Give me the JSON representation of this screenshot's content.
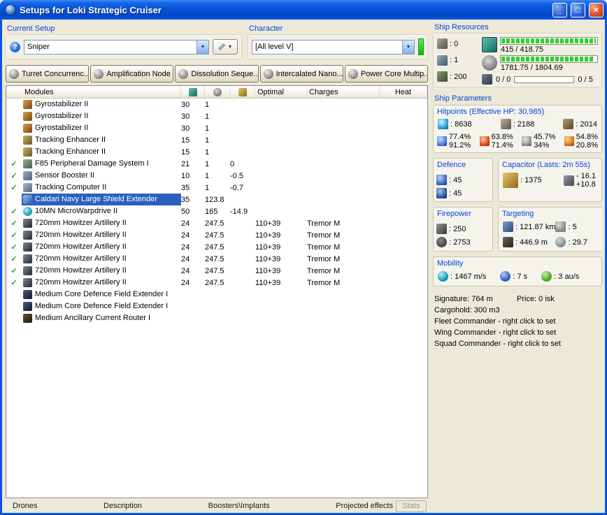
{
  "window": {
    "title": "Setups for Loki Strategic Cruiser"
  },
  "icons": {
    "help": "?",
    "dropdown_arrow": "▼",
    "check": "✓",
    "minimize": "_",
    "maximize": "□",
    "close": "×"
  },
  "current_setup": {
    "label": "Current Setup",
    "value": "Sniper"
  },
  "character": {
    "label": "Character",
    "value": "[All level V]"
  },
  "ship_resources": {
    "label": "Ship Resources",
    "turrets": ": 0",
    "launchers": ": 1",
    "calibration": ": 200",
    "cpu": "415 / 418.75",
    "powergrid": "1781.75 / 1804.69",
    "slots_left": "0 / 0",
    "slots_right": "0 / 5"
  },
  "subsystems": [
    {
      "label": "Turret Concurrenc..."
    },
    {
      "label": "Amplification Node"
    },
    {
      "label": "Dissolution Seque..."
    },
    {
      "label": "Intercalated Nano..."
    },
    {
      "label": "Power Core Multip..."
    }
  ],
  "modules": {
    "header": {
      "name": "Modules",
      "optimal": "Optimal",
      "charges": "Charges",
      "heat": "Heat"
    },
    "rows": [
      {
        "active": false,
        "selected": false,
        "icon": "gyro",
        "name": "Gyrostabilizer II",
        "cpu": "30",
        "pg": "1",
        "cap": "",
        "optimal": "",
        "charges": "",
        "heat": ""
      },
      {
        "active": false,
        "selected": false,
        "icon": "gyro",
        "name": "Gyrostabilizer II",
        "cpu": "30",
        "pg": "1",
        "cap": "",
        "optimal": "",
        "charges": "",
        "heat": ""
      },
      {
        "active": false,
        "selected": false,
        "icon": "gyro",
        "name": "Gyrostabilizer II",
        "cpu": "30",
        "pg": "1",
        "cap": "",
        "optimal": "",
        "charges": "",
        "heat": ""
      },
      {
        "active": false,
        "selected": false,
        "icon": "te",
        "name": "Tracking Enhancer II",
        "cpu": "15",
        "pg": "1",
        "cap": "",
        "optimal": "",
        "charges": "",
        "heat": ""
      },
      {
        "active": false,
        "selected": false,
        "icon": "te",
        "name": "Tracking Enhancer II",
        "cpu": "15",
        "pg": "1",
        "cap": "",
        "optimal": "",
        "charges": "",
        "heat": ""
      },
      {
        "active": true,
        "selected": false,
        "icon": "f85",
        "name": "F85 Peripheral Damage System I",
        "cpu": "21",
        "pg": "1",
        "cap": "0",
        "optimal": "",
        "charges": "",
        "heat": ""
      },
      {
        "active": true,
        "selected": false,
        "icon": "sebo",
        "name": "Sensor Booster II",
        "cpu": "10",
        "pg": "1",
        "cap": "-0.5",
        "optimal": "",
        "charges": "",
        "heat": ""
      },
      {
        "active": true,
        "selected": false,
        "icon": "tc",
        "name": "Tracking Computer II",
        "cpu": "35",
        "pg": "1",
        "cap": "-0.7",
        "optimal": "",
        "charges": "",
        "heat": ""
      },
      {
        "active": false,
        "selected": true,
        "icon": "shieldext",
        "name": "Caldari Navy Large Shield Extender",
        "cpu": "35",
        "pg": "123.8",
        "cap": "",
        "optimal": "",
        "charges": "",
        "heat": ""
      },
      {
        "active": true,
        "selected": false,
        "icon": "mwd",
        "name": "10MN MicroWarpdrive II",
        "cpu": "50",
        "pg": "165",
        "cap": "-14.9",
        "optimal": "",
        "charges": "",
        "heat": ""
      },
      {
        "active": true,
        "selected": false,
        "icon": "arty",
        "name": "720mm Howitzer Artillery II",
        "cpu": "24",
        "pg": "247.5",
        "cap": "",
        "optimal": "110+39",
        "charges": "Tremor M",
        "heat": ""
      },
      {
        "active": true,
        "selected": false,
        "icon": "arty",
        "name": "720mm Howitzer Artillery II",
        "cpu": "24",
        "pg": "247.5",
        "cap": "",
        "optimal": "110+39",
        "charges": "Tremor M",
        "heat": ""
      },
      {
        "active": true,
        "selected": false,
        "icon": "arty",
        "name": "720mm Howitzer Artillery II",
        "cpu": "24",
        "pg": "247.5",
        "cap": "",
        "optimal": "110+39",
        "charges": "Tremor M",
        "heat": ""
      },
      {
        "active": true,
        "selected": false,
        "icon": "arty",
        "name": "720mm Howitzer Artillery II",
        "cpu": "24",
        "pg": "247.5",
        "cap": "",
        "optimal": "110+39",
        "charges": "Tremor M",
        "heat": ""
      },
      {
        "active": true,
        "selected": false,
        "icon": "arty",
        "name": "720mm Howitzer Artillery II",
        "cpu": "24",
        "pg": "247.5",
        "cap": "",
        "optimal": "110+39",
        "charges": "Tremor M",
        "heat": ""
      },
      {
        "active": true,
        "selected": false,
        "icon": "arty",
        "name": "720mm Howitzer Artillery II",
        "cpu": "24",
        "pg": "247.5",
        "cap": "",
        "optimal": "110+39",
        "charges": "Tremor M",
        "heat": ""
      },
      {
        "active": false,
        "selected": false,
        "icon": "rigshield",
        "name": "Medium Core Defence Field Extender I",
        "cpu": "",
        "pg": "",
        "cap": "",
        "optimal": "",
        "charges": "",
        "heat": ""
      },
      {
        "active": false,
        "selected": false,
        "icon": "rigshield",
        "name": "Medium Core Defence Field Extender I",
        "cpu": "",
        "pg": "",
        "cap": "",
        "optimal": "",
        "charges": "",
        "heat": ""
      },
      {
        "active": false,
        "selected": false,
        "icon": "rigacr",
        "name": "Medium Ancillary Current Router I",
        "cpu": "",
        "pg": "",
        "cap": "",
        "optimal": "",
        "charges": "",
        "heat": ""
      }
    ]
  },
  "bottom_tabs": [
    {
      "label": "Drones"
    },
    {
      "label": "Description"
    },
    {
      "label": "Boosters\\Implants"
    },
    {
      "label": "Projected effects"
    }
  ],
  "stats_button_label": "Stats",
  "ship_parameters": {
    "label": "Ship Parameters",
    "hitpoints": {
      "label": "Hitpoints (Effective HP: 30,985)",
      "shield": ": 8638",
      "armor": ": 2188",
      "structure": ": 2014",
      "resists": [
        {
          "type": "em",
          "shield": "77.4%",
          "armor": "91.2%"
        },
        {
          "type": "thermal",
          "shield": "63.8%",
          "armor": "71.4%"
        },
        {
          "type": "kinetic",
          "shield": "45.7%",
          "armor": "34%"
        },
        {
          "type": "explosive",
          "shield": "54.8%",
          "armor": "20.8%"
        }
      ]
    },
    "defence": {
      "label": "Defence",
      "line1": ": 45",
      "line2": ": 45"
    },
    "capacitor": {
      "label": "Capacitor (Lasts: 2m 55s)",
      "capacity": ": 1375",
      "usage": "- 16.1",
      "recharge": "+10.8"
    },
    "firepower": {
      "label": "Firepower",
      "volley": ": 250",
      "dps": ": 2753"
    },
    "targeting": {
      "label": "Targeting",
      "range": ": 121.87 km",
      "max_targets": ": 5",
      "scan_resolution": ": 446.9 m",
      "sensor_strength": ": 29.7"
    },
    "mobility": {
      "label": "Mobility",
      "speed": ": 1467 m/s",
      "align_time": ": 7 s",
      "warp_speed": ": 3 au/s"
    },
    "info": {
      "signature": "Signature: 764 m",
      "price": "Price: 0 isk",
      "cargohold": "Cargohold: 300 m3",
      "fleet": "Fleet Commander - right click to set",
      "wing": "Wing Commander - right click to set",
      "squad": "Squad Commander - right click to set"
    }
  }
}
